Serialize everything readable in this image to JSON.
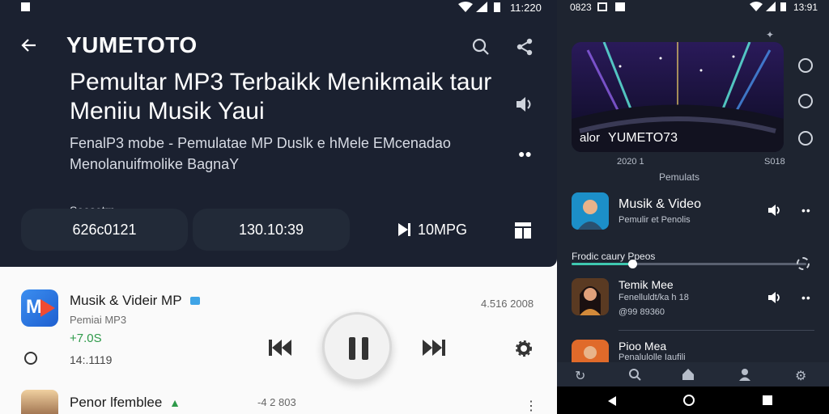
{
  "left": {
    "status": {
      "time": "11:220"
    },
    "header": {
      "title": "YUMETOTO"
    },
    "hero": {
      "headline_line1": "Pemultar MP3 Terbaikk Menikmaik taur",
      "headline_line2": "Meniiu Musik Yaui",
      "subtitle_line1": "FenalP3 mobe - Pemulatae MP Duslk e hMele EMcenadao",
      "subtitle_line2": "Menolanuifmolike BagnaY"
    },
    "stats": {
      "label": "Soosetrn",
      "stat1": "626c0121",
      "stat2": "130.10:39",
      "stat3": "10MPG"
    },
    "app_row": {
      "title": "Musik & Videir MP",
      "subtitle": "Pemiai MP3",
      "rating": "+7.0S",
      "duration": "14:.1119",
      "date": "4.516 2008"
    },
    "second_row": {
      "title": "Penor lfemblee",
      "date": "-4 2 803"
    }
  },
  "right": {
    "status": {
      "left_time": "0823",
      "time": "13:91"
    },
    "album": {
      "prefix": "alor",
      "title": "YUMETO73"
    },
    "album_meta": {
      "left": "2020 1",
      "right": "S018",
      "caption": "Pemulats"
    },
    "items": [
      {
        "title": "Musik & Video",
        "subtitle": "Pemulir et Penolis"
      },
      {
        "title": "Temik Mee",
        "subtitle": "Fenelluldt/ka h 18",
        "extra": "@99 89360"
      },
      {
        "title": "Pioo Mea",
        "subtitle": "Penalulolle Iaufili"
      }
    ],
    "progress": {
      "label": "Frodic caury Ppeos",
      "fraction": 0.26
    },
    "colors": {
      "accent": "#3fc8b0"
    }
  }
}
